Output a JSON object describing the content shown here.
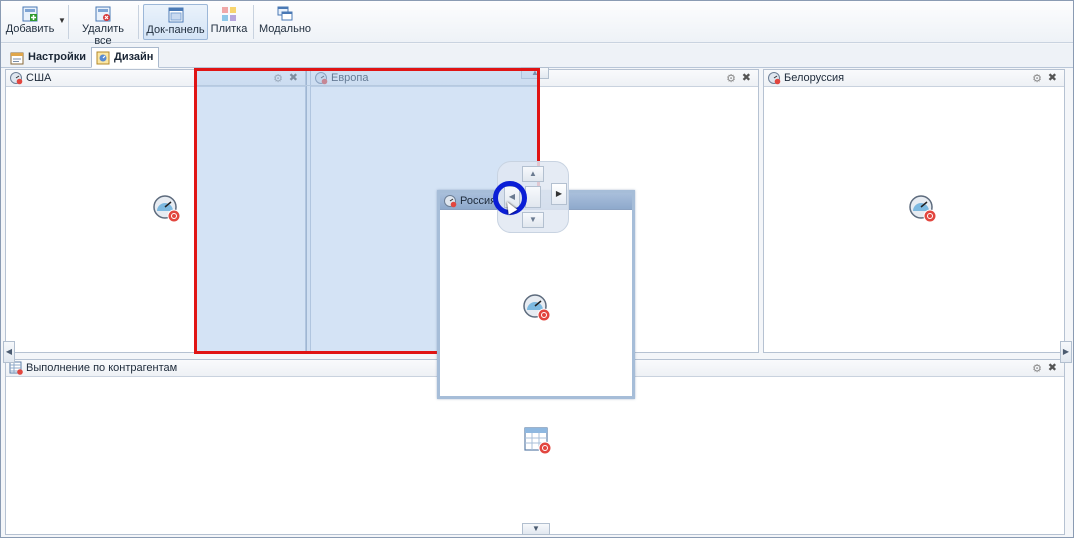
{
  "toolbar": {
    "add_label": "Добавить",
    "delete_all_label": "Удалить все",
    "dock_panel_label": "Док-панель",
    "tile_label": "Плитка",
    "modal_label": "Модально"
  },
  "tabs": [
    {
      "label": "Настройки"
    },
    {
      "label": "Дизайн",
      "active": true
    }
  ],
  "panels": {
    "usa": {
      "title": "США"
    },
    "europe": {
      "title": "Европа"
    },
    "belarus": {
      "title": "Белоруссия"
    },
    "contractors": {
      "title": "Выполнение по контрагентам"
    },
    "russia": {
      "title": "Россия"
    }
  },
  "colors": {
    "drop_preview_border": "#e01414",
    "drop_preview_fill": "#aac8eb",
    "cursor_ring": "#0a1ed6",
    "active_tool": "#d4e4f6"
  },
  "icons": {
    "panel_header": "dashboard-icon",
    "gauge": "gauge-icon",
    "table": "table-icon",
    "gear": "gear-icon",
    "close": "close-icon"
  }
}
